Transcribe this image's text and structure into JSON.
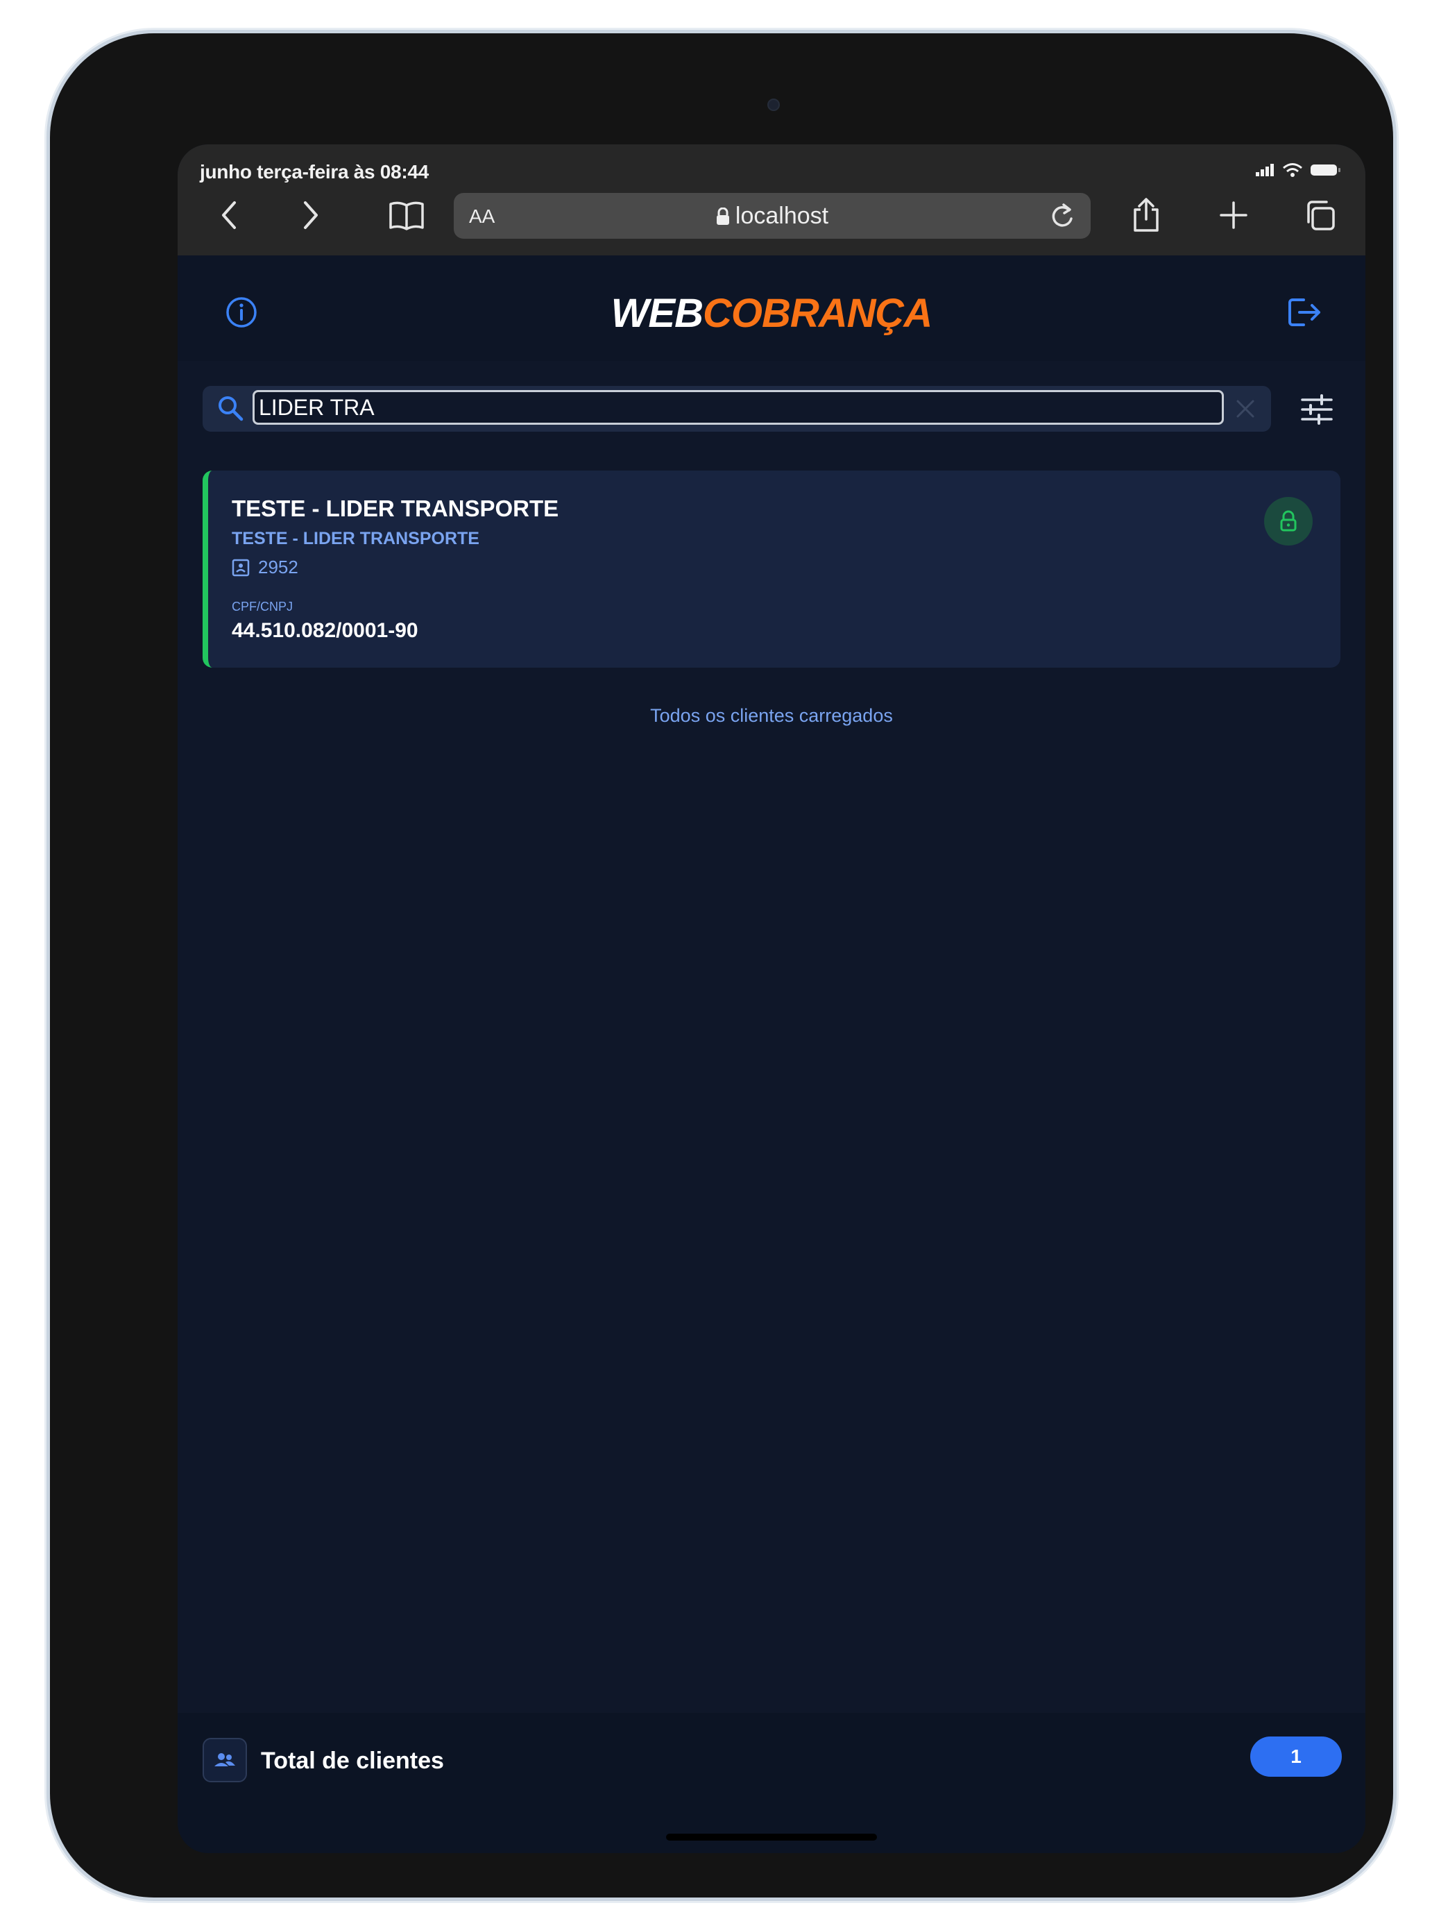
{
  "status_bar": {
    "time": "junho terça-feira às 08:44"
  },
  "browser": {
    "text_size_label": "AA",
    "url": "localhost"
  },
  "header": {
    "logo_part1": "WEB",
    "logo_part2": "COBRANÇA"
  },
  "search": {
    "value": "LIDER TRA",
    "placeholder": ""
  },
  "clients": [
    {
      "name": "TESTE - LIDER TRANSPORTE",
      "subtitle": "TESTE - LIDER TRANSPORTE",
      "code": "2952",
      "doc_label": "CPF/CNPJ",
      "doc": "44.510.082/0001-90"
    }
  ],
  "list_status": "Todos os clientes carregados",
  "footer": {
    "label": "Total de clientes",
    "count": "1"
  },
  "colors": {
    "accent": "#f97316",
    "primary": "#2d6ff2",
    "success": "#22c55e",
    "background": "#0f1729"
  }
}
